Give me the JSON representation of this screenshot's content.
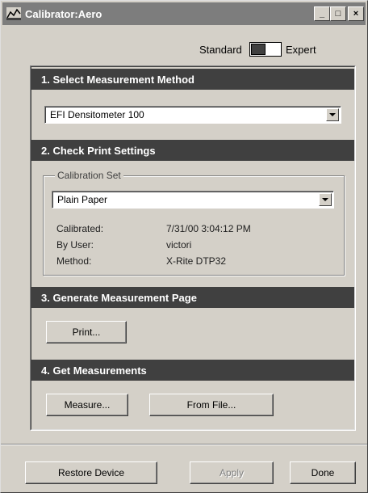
{
  "window": {
    "title": "Calibrator:Aero",
    "minimize_glyph": "_",
    "maximize_glyph": "□",
    "close_glyph": "×"
  },
  "mode": {
    "left_label": "Standard",
    "right_label": "Expert",
    "selected": "Standard"
  },
  "sections": {
    "s1": {
      "title": "1. Select Measurement Method",
      "method_value": "EFI Densitometer 100"
    },
    "s2": {
      "title": "2. Check Print Settings",
      "group_label": "Calibration Set",
      "set_value": "Plain Paper",
      "rows": [
        {
          "label": "Calibrated:",
          "value": "7/31/00 3:04:12 PM"
        },
        {
          "label": "By User:",
          "value": "victori"
        },
        {
          "label": "Method:",
          "value": "X-Rite DTP32"
        }
      ]
    },
    "s3": {
      "title": "3. Generate Measurement Page",
      "print_label": "Print..."
    },
    "s4": {
      "title": "4. Get Measurements",
      "measure_label": "Measure...",
      "from_file_label": "From File..."
    }
  },
  "footer": {
    "restore_label": "Restore Device",
    "apply_label": "Apply",
    "done_label": "Done"
  }
}
